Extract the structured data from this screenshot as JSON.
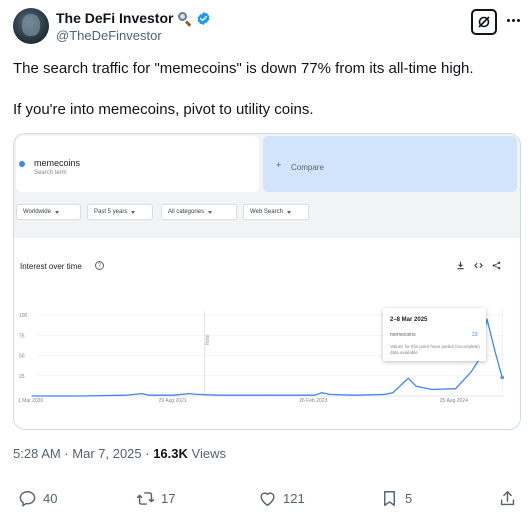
{
  "author": {
    "display_name": "The DeFi Investor",
    "name_emoji_icon": "magnifying-glass-icon",
    "verified_color": "#1d9bf0",
    "handle": "@TheDeFinvestor"
  },
  "tweet": {
    "line1": "The search traffic for \"memecoins\" is down 77% from its all-time high.",
    "line2": "If you're into memecoins, pivot to utility coins."
  },
  "trends": {
    "search_term": "memecoins",
    "search_term_sub": "Search term",
    "compare_plus": "+",
    "compare_label": "Compare",
    "filters": [
      "Worldwide",
      "Past 5 years",
      "All categories",
      "Web Search"
    ],
    "interest_title": "Interest over time",
    "help_glyph": "?",
    "y_ticks": [
      "100",
      "75",
      "50",
      "25"
    ],
    "note_label": "Note",
    "tooltip": {
      "date": "2–8 Mar 2025",
      "term": "memecoins",
      "value": "23",
      "note": "Values for this point have partial (incomplete) data available"
    },
    "series_color": "#4285f4"
  },
  "chart_data": {
    "type": "line",
    "title": "Interest over time",
    "xlabel": "",
    "ylabel": "",
    "x_ticks": [
      "1 Mar 2020",
      "29 Aug 2021",
      "26 Feb 2023",
      "25 Aug 2024"
    ],
    "ylim": [
      0,
      100
    ],
    "grid": true,
    "series": [
      {
        "name": "memecoins",
        "x": [
          "2020-03",
          "2020-09",
          "2021-03",
          "2021-05",
          "2021-06",
          "2021-09",
          "2021-11",
          "2021-12",
          "2022-03",
          "2022-09",
          "2023-03",
          "2023-04",
          "2023-05",
          "2023-08",
          "2023-12",
          "2024-01",
          "2024-03",
          "2024-04",
          "2024-06",
          "2024-09",
          "2024-11",
          "2024-12",
          "2025-01",
          "2025-02",
          "2025-03"
        ],
        "values": [
          0,
          0,
          1,
          3,
          1,
          1,
          3,
          2,
          1,
          1,
          1,
          4,
          2,
          1,
          2,
          4,
          22,
          12,
          8,
          9,
          30,
          45,
          95,
          55,
          23
        ]
      }
    ]
  },
  "meta": {
    "time": "5:28 AM",
    "sep1": " · ",
    "date": "Mar 7, 2025",
    "sep2": " · ",
    "views_count": "16.3K",
    "views_label": " Views"
  },
  "actions": {
    "replies": "40",
    "reposts": "17",
    "likes": "121",
    "bookmarks": "5"
  }
}
